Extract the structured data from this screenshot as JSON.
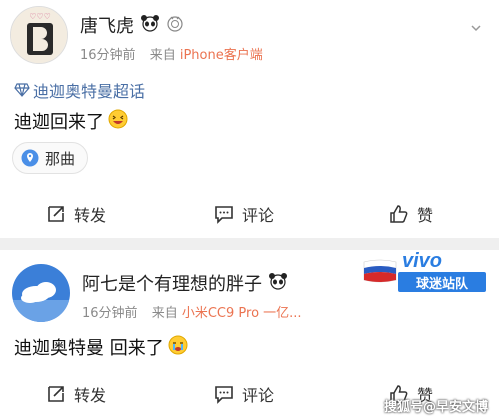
{
  "post1": {
    "user_name": "唐飞虎",
    "time": "16分钟前",
    "source_prefix": "来自",
    "device": "iPhone客户端",
    "topic": "迪迦奥特曼超话",
    "text": "迪迦回来了",
    "location": "那曲",
    "actions": {
      "repost": "转发",
      "comment": "评论",
      "like": "赞"
    }
  },
  "post2": {
    "user_name": "阿七是个有理想的胖子",
    "time": "16分钟前",
    "source_prefix": "来自",
    "device": "小米CC9 Pro 一亿...",
    "text": "迪迦奥特曼 回来了",
    "badge_brand": "vivo",
    "badge_label": "球迷站队",
    "actions": {
      "repost": "转发",
      "comment": "评论",
      "like": "赞"
    }
  },
  "watermark": "搜狐号@早安文博",
  "colors": {
    "meta": "#8a8a8a",
    "device": "#eb7350",
    "topic": "#4a6fa5",
    "vivo": "#2a7de1"
  }
}
